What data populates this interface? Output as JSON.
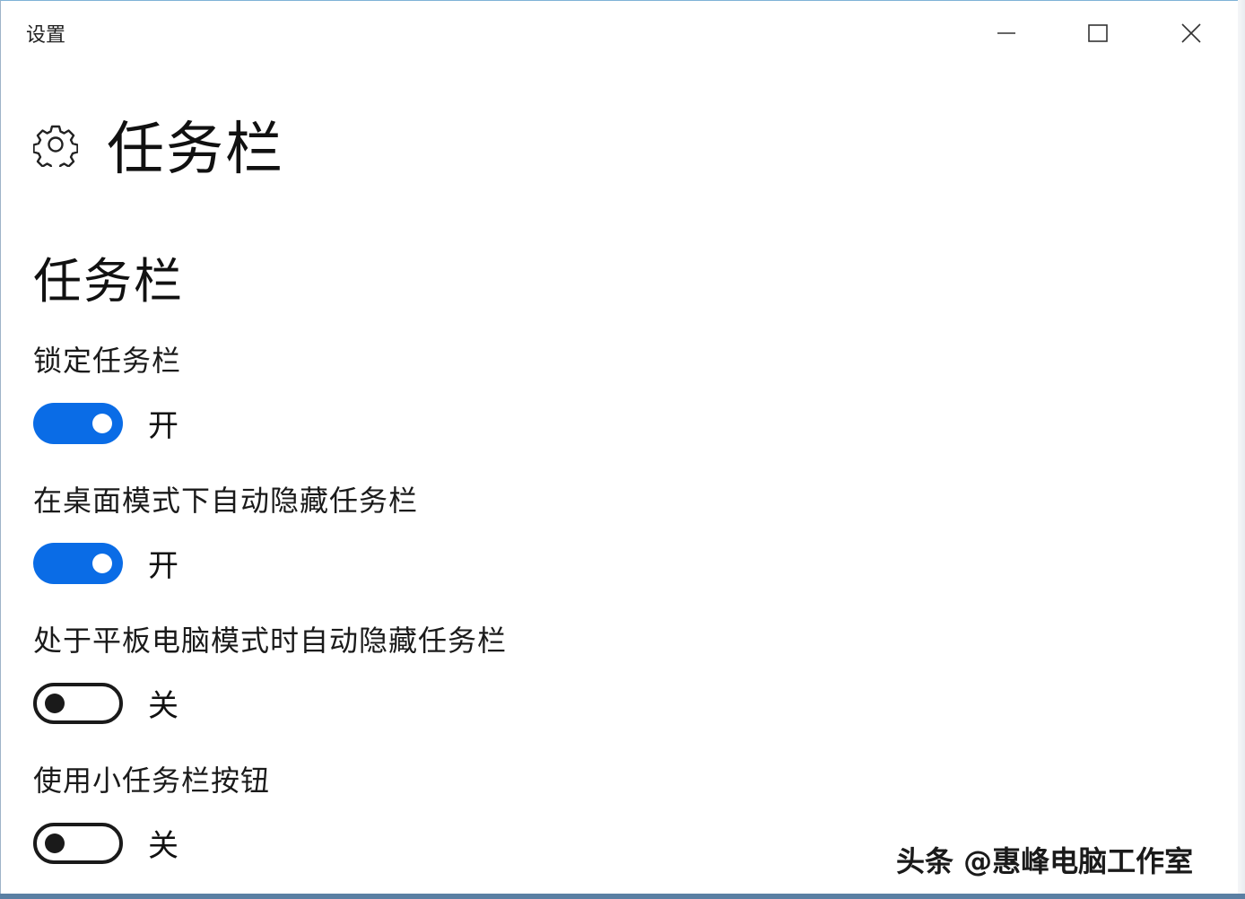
{
  "window": {
    "title": "设置",
    "minimize_icon": "minimize-icon",
    "maximize_icon": "maximize-icon",
    "close_icon": "close-icon"
  },
  "page": {
    "icon": "gear-icon",
    "title": "任务栏"
  },
  "section": {
    "title": "任务栏"
  },
  "settings": [
    {
      "label": "锁定任务栏",
      "state": "开",
      "on": true
    },
    {
      "label": "在桌面模式下自动隐藏任务栏",
      "state": "开",
      "on": true
    },
    {
      "label": "处于平板电脑模式时自动隐藏任务栏",
      "state": "关",
      "on": false
    },
    {
      "label": "使用小任务栏按钮",
      "state": "关",
      "on": false
    }
  ],
  "watermark": "头条 @惠峰电脑工作室",
  "colors": {
    "toggle_on": "#0a6ce6",
    "toggle_off_border": "#1a1a1a",
    "background": "#ffffff"
  }
}
